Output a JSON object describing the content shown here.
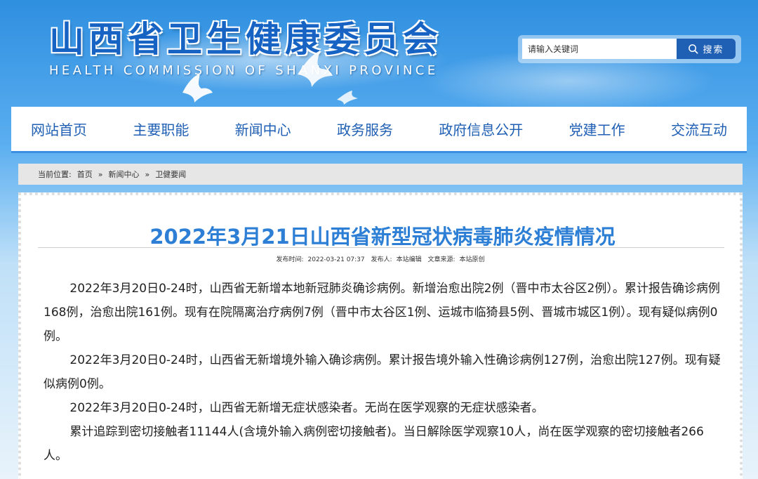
{
  "header": {
    "title_cn": "山西省卫生健康委员会",
    "title_en": "HEALTH COMMISSION OF SHANXI PROVINCE"
  },
  "search": {
    "placeholder": "请输入关键词",
    "button_label": "搜索"
  },
  "nav": {
    "items": [
      "网站首页",
      "主要职能",
      "新闻中心",
      "政务服务",
      "政府信息公开",
      "党建工作",
      "交流互动"
    ]
  },
  "breadcrumb": {
    "label": "当前位置:",
    "items": [
      "首页",
      "新闻中心",
      "卫健要闻"
    ],
    "separator": "»"
  },
  "article": {
    "title": "2022年3月21日山西省新型冠状病毒肺炎疫情情况",
    "meta": {
      "publish_label": "发布时间:",
      "publish_time": "2022-03-21 07:37",
      "publisher_label": "发布人:",
      "publisher": "本站编辑",
      "source_label": "文章来源:",
      "source": "本站原创"
    },
    "paragraphs": [
      "2022年3月20日0-24时，山西省无新增本地新冠肺炎确诊病例。新增治愈出院2例（晋中市太谷区2例）。累计报告确诊病例168例，治愈出院161例。现有在院隔离治疗病例7例（晋中市太谷区1例、运城市临猗县5例、晋城市城区1例）。现有疑似病例0例。",
      "2022年3月20日0-24时，山西省无新增境外输入确诊病例。累计报告境外输入性确诊病例127例，治愈出院127例。现有疑似病例0例。",
      "2022年3月20日0-24时，山西省无新增无症状感染者。无尚在医学观察的无症状感染者。",
      "累计追踪到密切接触者11144人(含境外输入病例密切接触者)。当日解除医学观察10人，尚在医学观察的密切接触者266人。"
    ]
  },
  "colors": {
    "brand_blue": "#1f5fb4",
    "title_blue": "#2d7fd6"
  }
}
